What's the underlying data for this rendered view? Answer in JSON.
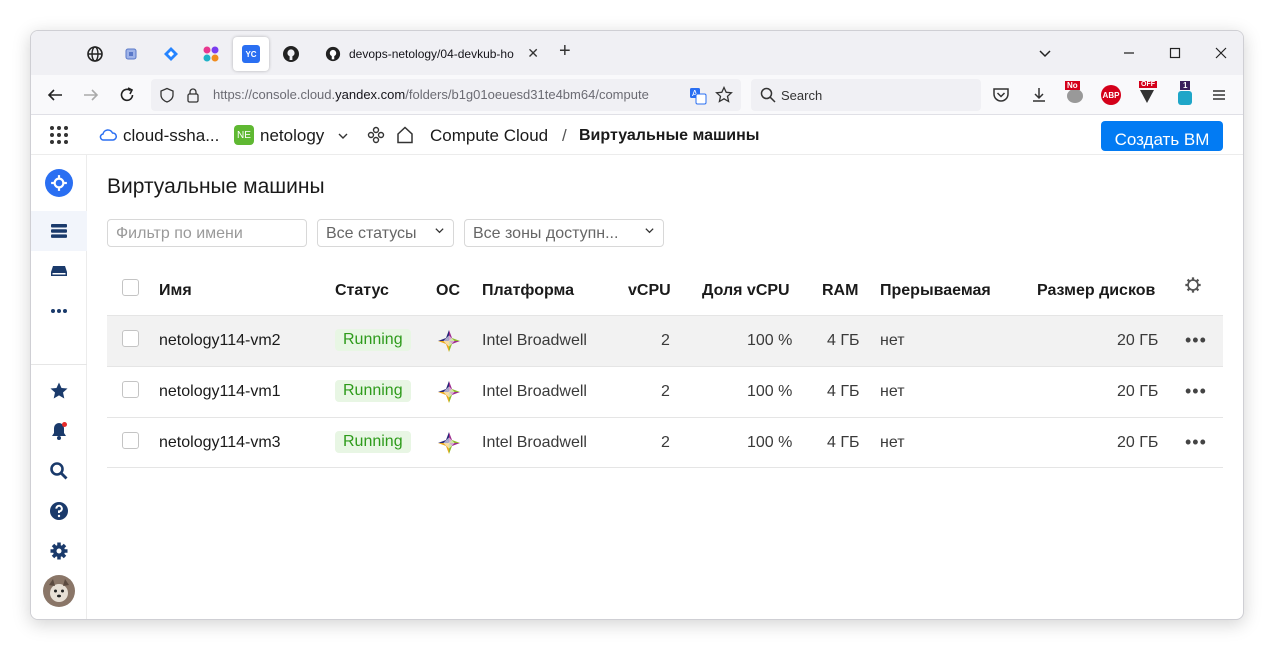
{
  "browser": {
    "tab_title": "devops-netology/04-devkub-ho",
    "yc_tab_label": "YC",
    "url_prefix": "https://console.cloud.",
    "url_domain": "yandex.com",
    "url_suffix": "/folders/b1g01oeuesd31te4bm64/compute",
    "search_placeholder": "Search",
    "ext_badges": {
      "noscript": "No",
      "off": "OFF",
      "count": "1",
      "abp": "ABP"
    }
  },
  "console": {
    "cloud_name": "cloud-ssha...",
    "folder_badge": "NE",
    "folder_name": "netology",
    "service": "Compute Cloud",
    "separator": "/",
    "current_page": "Виртуальные машины",
    "create_button": "Создать ВМ"
  },
  "page": {
    "title": "Виртуальные машины",
    "filter_placeholder": "Фильтр по имени",
    "status_select": "Все статусы",
    "zone_select": "Все зоны доступн..."
  },
  "table": {
    "columns": {
      "name": "Имя",
      "status": "Статус",
      "os": "ОС",
      "platform": "Платформа",
      "vcpu": "vCPU",
      "vcpu_share": "Доля vCPU",
      "ram": "RAM",
      "preemptible": "Прерываемая",
      "disk_size": "Размер дисков"
    },
    "rows": [
      {
        "name": "netology114-vm2",
        "status": "Running",
        "platform": "Intel Broadwell",
        "vcpu": "2",
        "vcpu_share": "100 %",
        "ram": "4 ГБ",
        "preemptible": "нет",
        "disk_size": "20 ГБ"
      },
      {
        "name": "netology114-vm1",
        "status": "Running",
        "platform": "Intel Broadwell",
        "vcpu": "2",
        "vcpu_share": "100 %",
        "ram": "4 ГБ",
        "preemptible": "нет",
        "disk_size": "20 ГБ"
      },
      {
        "name": "netology114-vm3",
        "status": "Running",
        "platform": "Intel Broadwell",
        "vcpu": "2",
        "vcpu_share": "100 %",
        "ram": "4 ГБ",
        "preemptible": "нет",
        "disk_size": "20 ГБ"
      }
    ]
  },
  "colors": {
    "accent": "#027bf3",
    "status_text": "#2e9b1b",
    "status_bg": "#e8f6e4"
  }
}
